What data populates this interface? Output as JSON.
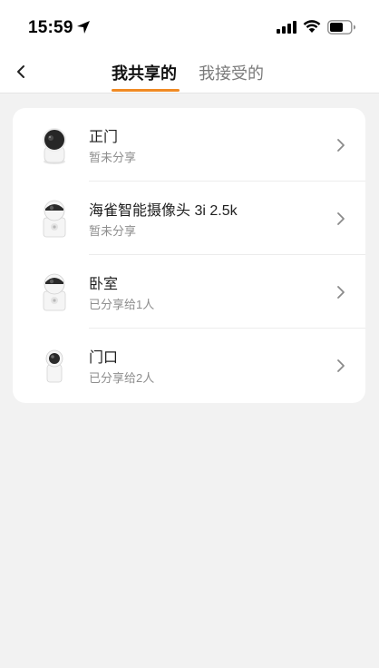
{
  "status_bar": {
    "time": "15:59"
  },
  "nav": {
    "tabs": [
      {
        "label": "我共享的",
        "active": true
      },
      {
        "label": "我接受的",
        "active": false
      }
    ]
  },
  "devices": [
    {
      "name": "正门",
      "status": "暂未分享",
      "icon": "dome-camera-icon"
    },
    {
      "name": "海雀智能摄像头 3i 2.5k",
      "status": "暂未分享",
      "icon": "pan-tilt-camera-icon"
    },
    {
      "name": "卧室",
      "status": "已分享给1人",
      "icon": "pan-tilt-camera-icon"
    },
    {
      "name": "门口",
      "status": "已分享给2人",
      "icon": "mini-camera-icon"
    }
  ],
  "colors": {
    "accent": "#f08a24",
    "background": "#f2f2f2",
    "card": "#ffffff",
    "secondary_text": "#8e8e8e"
  }
}
